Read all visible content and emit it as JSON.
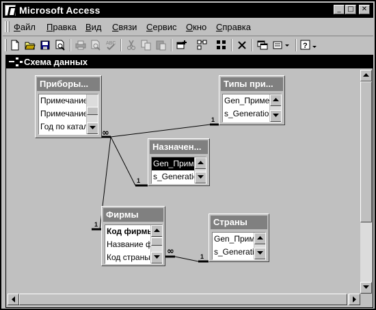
{
  "window": {
    "title": "Microsoft Access",
    "minimize_glyph": "_",
    "maximize_glyph": "□",
    "close_glyph": "✕"
  },
  "menubar": {
    "items": [
      {
        "accel": "Ф",
        "rest": "айл"
      },
      {
        "accel": "П",
        "rest": "равка"
      },
      {
        "accel": "В",
        "rest": "ид"
      },
      {
        "accel": "С",
        "rest": "вязи"
      },
      {
        "accel": "С",
        "rest": "ервис"
      },
      {
        "accel": "О",
        "rest": "кно"
      },
      {
        "accel": "С",
        "rest": "правка"
      }
    ]
  },
  "toolbar": {
    "buttons": [
      "new-icon",
      "open-icon",
      "save-icon",
      "print-preview-icon",
      "print-icon",
      "preview-icon",
      "spelling-icon",
      "cut-icon",
      "copy-icon",
      "paste-icon",
      "show-table-icon",
      "show-direct-icon",
      "show-all-icon",
      "delete-icon",
      "window-icon",
      "new-object-icon",
      "help-icon"
    ]
  },
  "child_window": {
    "title": "Схема данных"
  },
  "tables": [
    {
      "name": "Приборы...",
      "fields": [
        {
          "text": "Примечание"
        },
        {
          "text": "Примечание"
        },
        {
          "text": "Год по каталогу"
        }
      ]
    },
    {
      "name": "Типы при...",
      "fields": [
        {
          "text": "Gen_Примечание"
        },
        {
          "text": "s_Generation"
        }
      ]
    },
    {
      "name": "Назначен...",
      "fields": [
        {
          "text": "Gen_Примечание",
          "selected": true
        },
        {
          "text": "s_Generation"
        }
      ]
    },
    {
      "name": "Фирмы",
      "fields": [
        {
          "text": "Код фирмы",
          "key": true
        },
        {
          "text": "Название фирмы"
        },
        {
          "text": "Код страны"
        }
      ]
    },
    {
      "name": "Страны",
      "fields": [
        {
          "text": "Gen_Примечание"
        },
        {
          "text": "s_Generation"
        }
      ]
    }
  ],
  "relationships": [
    {
      "from": "Приборы...",
      "to": "Типы при...",
      "from_label": "∞",
      "to_label": "1"
    },
    {
      "from": "Приборы...",
      "to": "Назначен...",
      "from_label": "∞",
      "to_label": "1"
    },
    {
      "from": "Приборы...",
      "to": "Фирмы",
      "from_label": "∞",
      "to_label": "1"
    },
    {
      "from": "Фирмы",
      "to": "Страны",
      "from_label": "∞",
      "to_label": "1"
    }
  ],
  "colors": {
    "title_bg": "#000000",
    "face": "#c0c0c0",
    "table_header": "#808080",
    "selection": "#000000"
  }
}
